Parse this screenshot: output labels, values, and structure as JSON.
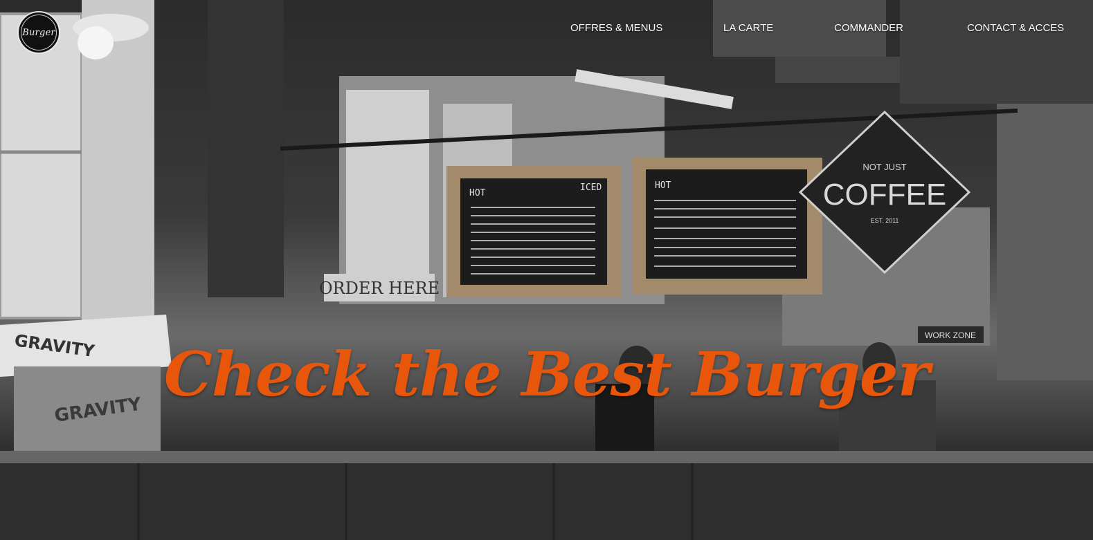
{
  "logo": {
    "text": "Burger",
    "icon": "burger-logo-badge"
  },
  "nav": {
    "items": [
      {
        "label": "OFFRES & MENUS"
      },
      {
        "label": "LA CARTE"
      },
      {
        "label": "COMMANDER"
      },
      {
        "label": "CONTACT & ACCES"
      }
    ]
  },
  "hero": {
    "headline": "Check the Best Burger",
    "signs": {
      "order_here": "ORDER HERE",
      "gravity": "GRAVITY",
      "work_zone": "WORK ZONE",
      "not_just": "NOT JUST",
      "coffee": "COFFEE",
      "est": "EST. 2011",
      "hot": "HOT",
      "iced": "ICED"
    }
  },
  "colors": {
    "accent": "#e8560c",
    "nav_text": "#ffffff"
  }
}
